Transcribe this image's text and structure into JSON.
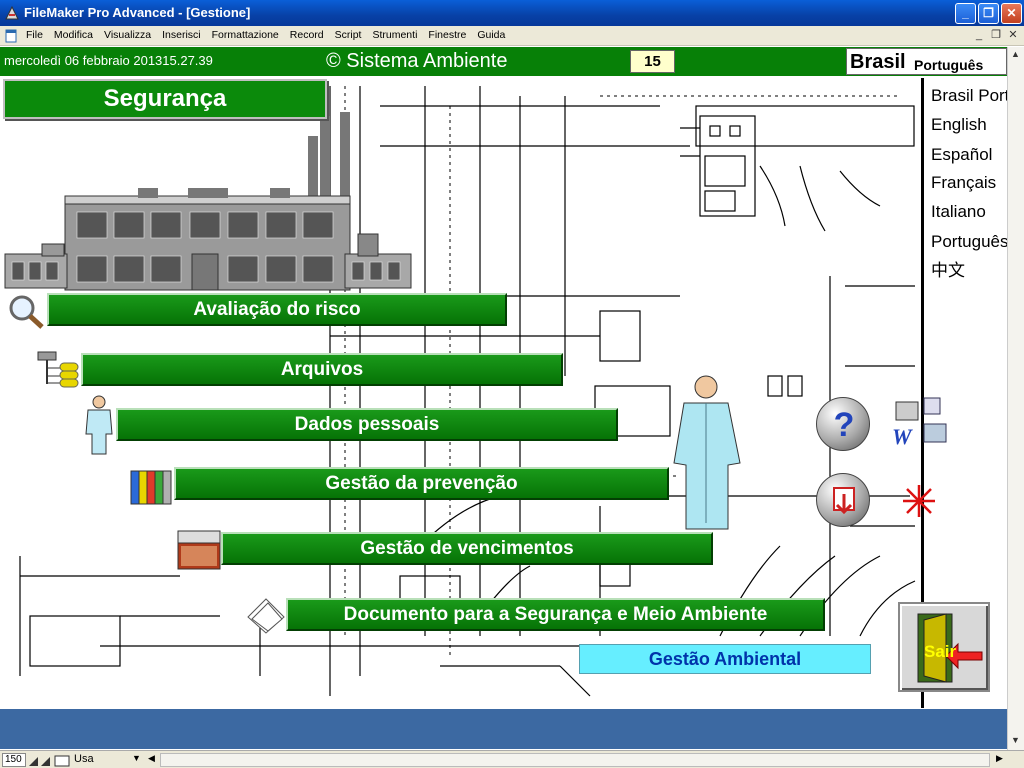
{
  "window": {
    "title": "FileMaker Pro Advanced - [Gestione]",
    "minimize_glyph": "_",
    "restore_glyph": "❐",
    "close_glyph": "✕"
  },
  "menubar": {
    "items": [
      "File",
      "Modifica",
      "Visualizza",
      "Inserisci",
      "Formattazione",
      "Record",
      "Script",
      "Strumenti",
      "Finestre",
      "Guida"
    ],
    "doc_controls": [
      "_",
      "❐",
      "✕"
    ]
  },
  "header": {
    "datetime": "mercoledì 06 febbraio 201315.27.39",
    "brand": "© Sistema Ambiente",
    "badge": "15",
    "current_country": "Brasil",
    "current_language": "Português"
  },
  "page": {
    "title": "Segurança"
  },
  "languages": [
    "Brasil Port",
    "English",
    "Español",
    "Français",
    "Italiano",
    "Português",
    "中文"
  ],
  "menu": {
    "avaliacao": "Avaliação do risco",
    "arquivos": "Arquivos",
    "dados": "Dados pessoais",
    "prevencao": "Gestão da prevenção",
    "vencimentos": "Gestão de vencimentos",
    "documento": "Documento para a Segurança e Meio Ambiente",
    "ambiental": "Gestão Ambiental"
  },
  "exit": {
    "label": "Sair"
  },
  "statusbar": {
    "zoom": "150",
    "mode": "Usa"
  },
  "colors": {
    "green": "#078007",
    "titlebar": "#0841a6",
    "ambiental": "#66eeff",
    "footer": "#3c69a2"
  }
}
